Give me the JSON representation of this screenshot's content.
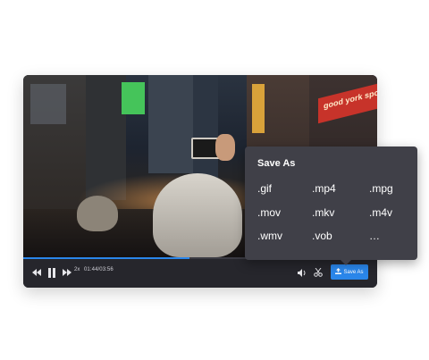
{
  "player": {
    "progress": 0.47,
    "speed_label": "2x",
    "time_display": "01:44/03:56",
    "save_label": "Save As",
    "accent_color": "#2a86ea"
  },
  "icons": {
    "rewind": "rewind-icon",
    "pause": "pause-icon",
    "fast_forward": "fast-forward-icon",
    "volume": "volume-icon",
    "cut": "scissors-icon",
    "upload": "upload-icon"
  },
  "save_as_panel": {
    "title": "Save As",
    "formats": [
      ".gif",
      ".mp4",
      ".mpg",
      ".mov",
      ".mkv",
      ".m4v",
      ".wmv",
      ".vob",
      "…"
    ]
  },
  "video_scene": {
    "sign_text": "good york spo"
  }
}
